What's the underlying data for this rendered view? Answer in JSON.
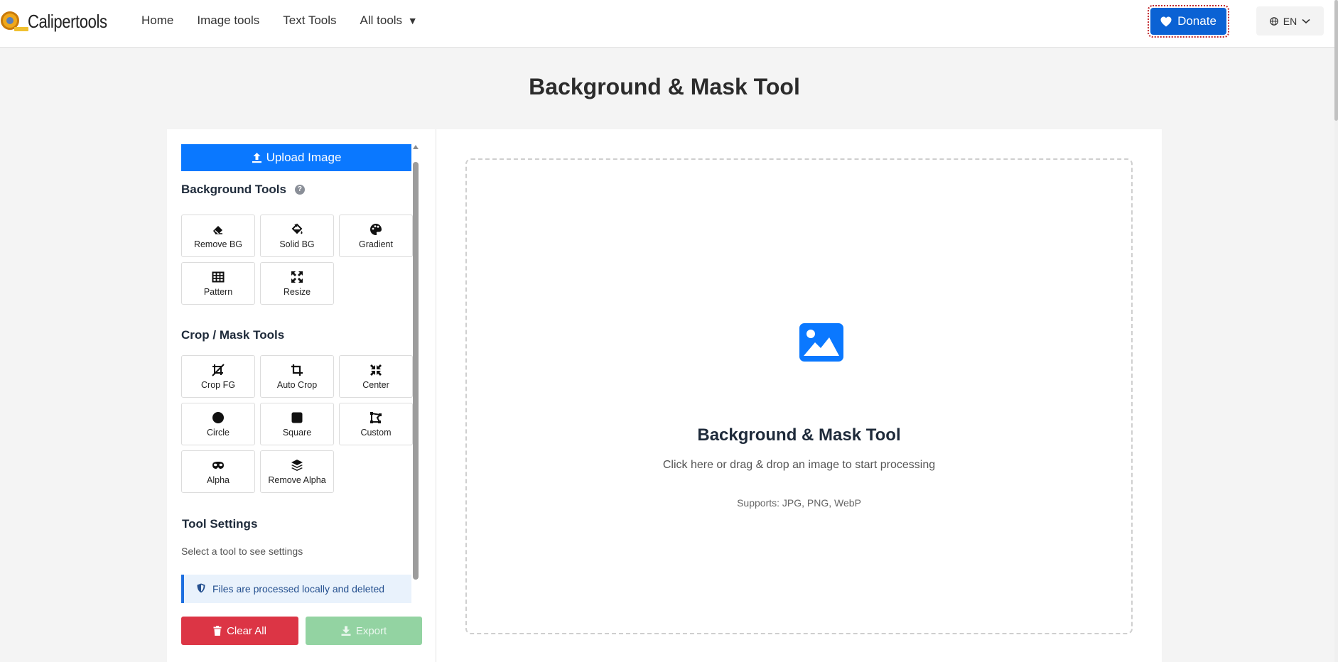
{
  "header": {
    "logo_text": "Calipertools",
    "nav": [
      {
        "label": "Home"
      },
      {
        "label": "Image tools"
      },
      {
        "label": "Text Tools"
      },
      {
        "label": "All tools",
        "caret": "▼"
      }
    ],
    "donate_label": "Donate",
    "language": "EN"
  },
  "page": {
    "title": "Background & Mask Tool"
  },
  "sidebar": {
    "upload_label": "Upload Image",
    "background_tools": {
      "title": "Background Tools",
      "help": "?",
      "items": [
        {
          "label": "Remove BG",
          "icon": "eraser-icon"
        },
        {
          "label": "Solid BG",
          "icon": "paint-bucket-icon"
        },
        {
          "label": "Gradient",
          "icon": "palette-icon"
        },
        {
          "label": "Pattern",
          "icon": "grid-pattern-icon"
        },
        {
          "label": "Resize",
          "icon": "expand-icon"
        }
      ]
    },
    "crop_tools": {
      "title": "Crop / Mask Tools",
      "items": [
        {
          "label": "Crop FG",
          "icon": "crop-slash-icon"
        },
        {
          "label": "Auto Crop",
          "icon": "crop-icon"
        },
        {
          "label": "Center",
          "icon": "compress-icon"
        },
        {
          "label": "Circle",
          "icon": "circle-icon"
        },
        {
          "label": "Square",
          "icon": "square-icon"
        },
        {
          "label": "Custom",
          "icon": "draw-polygon-icon"
        },
        {
          "label": "Alpha",
          "icon": "mask-icon"
        },
        {
          "label": "Remove Alpha",
          "icon": "layers-icon"
        }
      ]
    },
    "settings": {
      "title": "Tool Settings",
      "hint": "Select a tool to see settings"
    },
    "notice": "Files are processed locally and deleted",
    "clear_label": "Clear All",
    "export_label": "Export"
  },
  "dropzone": {
    "title": "Background & Mask Tool",
    "subtitle": "Click here or drag & drop an image to start processing",
    "supports": "Supports: JPG, PNG, WebP",
    "icon": "image-icon"
  },
  "colors": {
    "primary": "#0a78ff",
    "donate": "#0b62d4",
    "danger": "#dc3545",
    "success_disabled": "#93d3a2"
  }
}
